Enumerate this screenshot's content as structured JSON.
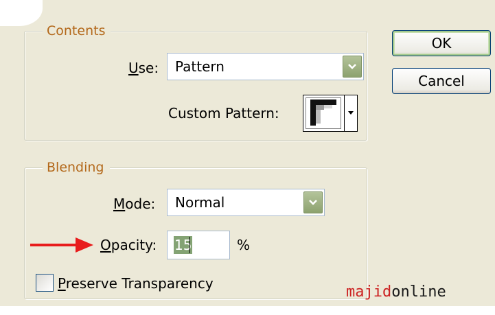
{
  "contents": {
    "legend": "Contents",
    "use_label": "Use:",
    "use_value": "Pattern",
    "custom_pattern_label": "Custom Pattern:"
  },
  "blending": {
    "legend": "Blending",
    "mode_label": "Mode:",
    "mode_value": "Normal",
    "opacity_label": "Opacity:",
    "opacity_value": "15",
    "opacity_unit": "%",
    "preserve_label": "Preserve Transparency",
    "preserve_checked": false
  },
  "buttons": {
    "ok": "OK",
    "cancel": "Cancel"
  },
  "watermark": {
    "part1": "majid",
    "part2": "online"
  },
  "colors": {
    "dialog_bg": "#ece9d8",
    "legend_text": "#b3681a",
    "arrow": "#e81c1c",
    "selection": "#84a374"
  },
  "icons": [
    "dropdown-arrow-icon",
    "pattern-preview-icon",
    "red-arrow-icon"
  ]
}
